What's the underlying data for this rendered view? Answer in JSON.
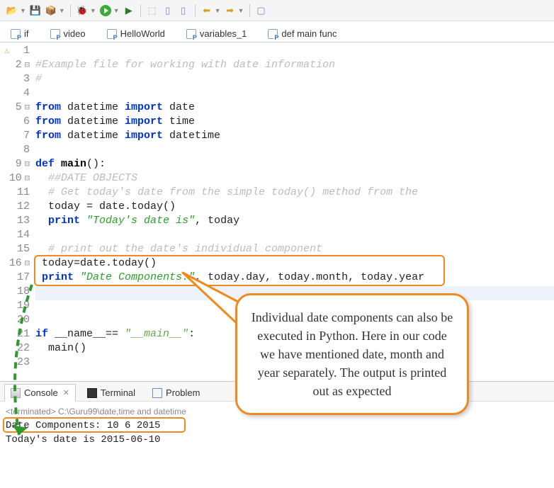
{
  "toolbar": {
    "icons": [
      "folder",
      "disk",
      "package",
      "bug",
      "run",
      "launch",
      "stop",
      "doc",
      "box",
      "back",
      "fwd",
      "sep",
      "square"
    ]
  },
  "tabs": [
    {
      "label": "if"
    },
    {
      "label": "video"
    },
    {
      "label": "HelloWorld"
    },
    {
      "label": "variables_1"
    },
    {
      "label": "def main func"
    }
  ],
  "code": {
    "lines": [
      {
        "n": 1,
        "warn": true,
        "seg": []
      },
      {
        "n": 2,
        "ominus": true,
        "seg": [
          {
            "t": "#Example file for working with date information",
            "c": "c-comment"
          }
        ]
      },
      {
        "n": 3,
        "seg": [
          {
            "t": "#",
            "c": "c-comment"
          }
        ]
      },
      {
        "n": 4,
        "seg": []
      },
      {
        "n": 5,
        "ominus": true,
        "seg": [
          {
            "t": "from",
            "c": "c-key"
          },
          {
            "t": " datetime ",
            "c": "c-plain"
          },
          {
            "t": "import",
            "c": "c-key"
          },
          {
            "t": " date",
            "c": "c-plain"
          }
        ]
      },
      {
        "n": 6,
        "seg": [
          {
            "t": "from",
            "c": "c-key"
          },
          {
            "t": " datetime ",
            "c": "c-plain"
          },
          {
            "t": "import",
            "c": "c-key"
          },
          {
            "t": " time",
            "c": "c-plain"
          }
        ]
      },
      {
        "n": 7,
        "seg": [
          {
            "t": "from",
            "c": "c-key"
          },
          {
            "t": " datetime ",
            "c": "c-plain"
          },
          {
            "t": "import",
            "c": "c-key"
          },
          {
            "t": " datetime",
            "c": "c-plain"
          }
        ]
      },
      {
        "n": 8,
        "seg": []
      },
      {
        "n": 9,
        "ominus": true,
        "seg": [
          {
            "t": "def ",
            "c": "c-key"
          },
          {
            "t": "main",
            "c": "c-def"
          },
          {
            "t": "():",
            "c": "c-plain"
          }
        ]
      },
      {
        "n": 10,
        "ominus": true,
        "seg": [
          {
            "t": "  ##DATE OBJECTS",
            "c": "c-comment"
          }
        ]
      },
      {
        "n": 11,
        "seg": [
          {
            "t": "  # Get today's date from the simple today() method from the",
            "c": "c-comment"
          }
        ]
      },
      {
        "n": 12,
        "seg": [
          {
            "t": "  today = date.today()",
            "c": "c-plain"
          }
        ]
      },
      {
        "n": 13,
        "seg": [
          {
            "t": "  ",
            "c": "c-plain"
          },
          {
            "t": "print",
            "c": "c-key"
          },
          {
            "t": " ",
            "c": "c-plain"
          },
          {
            "t": "\"Today's date is\"",
            "c": "c-str"
          },
          {
            "t": ", today",
            "c": "c-plain"
          }
        ]
      },
      {
        "n": 14,
        "seg": []
      },
      {
        "n": 15,
        "seg": [
          {
            "t": "  # print out the date's individual component",
            "c": "c-comment"
          }
        ]
      },
      {
        "n": 16,
        "ominus": true,
        "seg": [
          {
            "t": " today=date.today()",
            "c": "c-plain"
          }
        ]
      },
      {
        "n": 17,
        "seg": [
          {
            "t": " ",
            "c": "c-plain"
          },
          {
            "t": "print",
            "c": "c-key"
          },
          {
            "t": " ",
            "c": "c-plain"
          },
          {
            "t": "\"Date Components:\"",
            "c": "c-str"
          },
          {
            "t": ", today.day, today.month, today.year",
            "c": "c-plain"
          }
        ]
      },
      {
        "n": 18,
        "seg": []
      },
      {
        "n": 19,
        "seg": []
      },
      {
        "n": 20,
        "seg": []
      },
      {
        "n": 21,
        "seg": [
          {
            "t": "if",
            "c": "c-key"
          },
          {
            "t": " __name__== ",
            "c": "c-plain"
          },
          {
            "t": "\"__main__\"",
            "c": "c-strmain"
          },
          {
            "t": ":",
            "c": "c-plain"
          }
        ]
      },
      {
        "n": 22,
        "seg": [
          {
            "t": "  main()",
            "c": "c-plain"
          }
        ]
      },
      {
        "n": 23,
        "seg": []
      }
    ]
  },
  "callout": {
    "text": "Individual date components can also be executed in Python. Here in our code we have mentioned date, month and year separately. The output is printed out as expected"
  },
  "bottomTabs": {
    "console": "Console",
    "terminal": "Terminal",
    "problems": "Problem"
  },
  "console": {
    "status": "<terminated> C:\\Guru99\\date,time and datetime",
    "line1": "Date Components: 10 6 2015",
    "line2": "Today's date is 2015-06-10"
  }
}
